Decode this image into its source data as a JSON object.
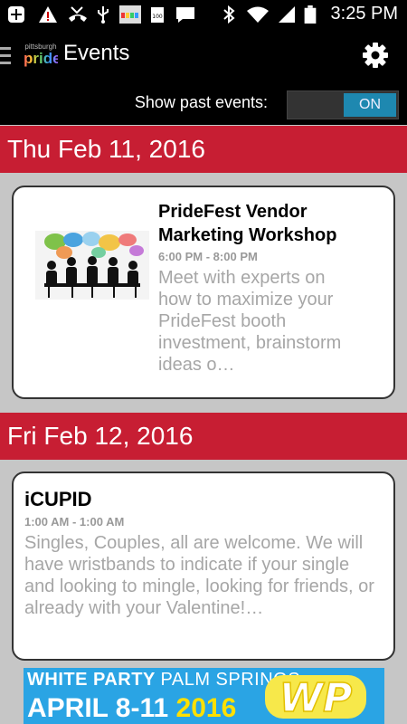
{
  "status_bar": {
    "time": "3:25 PM",
    "icons": [
      "add-icon",
      "warning-icon",
      "missed-call-icon",
      "usb-icon",
      "app-notification-icon",
      "battery-100-icon",
      "message-icon",
      "bluetooth-icon",
      "wifi-icon",
      "signal-icon",
      "battery-icon"
    ]
  },
  "app": {
    "title": "Events",
    "logo_top": "pittsburgh",
    "logo_main": "pride"
  },
  "filters": {
    "show_past_label": "Show past events:",
    "show_past_state": "ON"
  },
  "days": [
    {
      "date": "Thu Feb 11, 2016",
      "events": [
        {
          "title": "PrideFest Vendor Marketing Workshop",
          "time": "6:00 PM - 8:00 PM",
          "description": "Meet with experts on how to maximize your PrideFest booth investment, brainstorm ideas o…",
          "image": "meeting-silhouettes-speech-bubbles"
        }
      ]
    },
    {
      "date": "Fri Feb 12, 2016",
      "events": [
        {
          "title": "iCUPID",
          "time": "1:00 AM - 1:00 AM",
          "description": "Singles, Couples, all are welcome. We will have wristbands to indicate if your single and looking to mingle, looking for friends, or already with your Valentine!…"
        }
      ]
    }
  ],
  "ad_banner": {
    "line1_bold": "WHITE PARTY",
    "line1_light": "PALM SPRINGS",
    "line2_dates": "APRIL 8-11",
    "line2_year": "2016",
    "logo_text": "WP"
  },
  "colors": {
    "date_header": "#c71e33",
    "toggle_on": "#1e88b0",
    "banner": "#2aa4e4",
    "background": "#c6c6c6"
  }
}
